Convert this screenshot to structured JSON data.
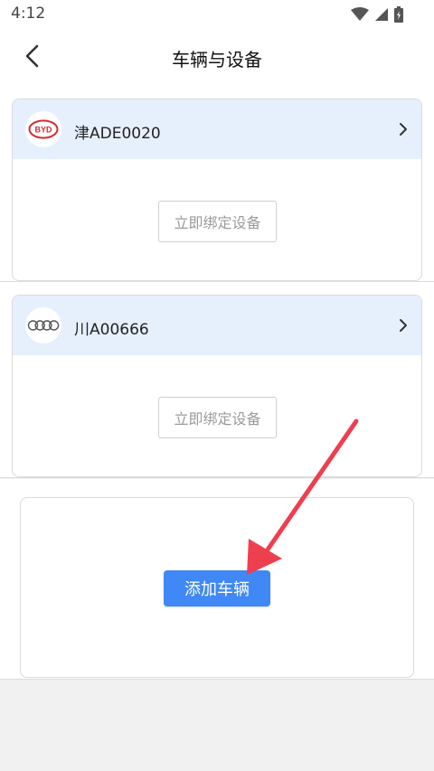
{
  "status_bar": {
    "time": "4:12",
    "icons": [
      "wifi-icon",
      "cellular-signal-icon",
      "battery-charging-icon"
    ]
  },
  "header": {
    "title": "车辆与设备",
    "back_icon": "back-arrow-icon"
  },
  "vehicles": [
    {
      "brand_logo": "byd-logo",
      "brand_logo_text": "BYD",
      "plate": "津ADE0020",
      "bind_button_label": "立即绑定设备",
      "chevron_icon": "chevron-right-icon"
    },
    {
      "brand_logo": "audi-rings-logo",
      "plate": "川A00666",
      "bind_button_label": "立即绑定设备",
      "chevron_icon": "chevron-right-icon"
    }
  ],
  "add_vehicle": {
    "button_label": "添加车辆"
  },
  "annotation": {
    "arrow_color": "#ee3f4f"
  },
  "colors": {
    "primary": "#3f88f5",
    "card_header_bg": "#e6f0fd",
    "page_bg": "#f1f1f1",
    "byd_red": "#d62b2f"
  }
}
